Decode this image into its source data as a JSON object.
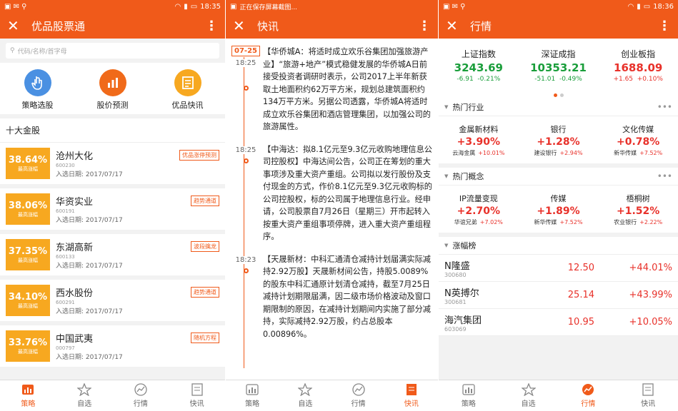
{
  "panel1": {
    "status_time": "18:35",
    "title": "优品股票通",
    "search_placeholder": "代码/名称/首字母",
    "shortcuts": [
      {
        "label": "策略选股",
        "color": "#4a90e2",
        "icon": "hand-pointer-icon"
      },
      {
        "label": "股价预测",
        "color": "#f06a1a",
        "icon": "bar-chart-icon"
      },
      {
        "label": "优品快讯",
        "color": "#f7a820",
        "icon": "news-doc-icon"
      }
    ],
    "section_title": "十大金股",
    "pct_label": "最高涨幅",
    "stocks": [
      {
        "pct": "38.64%",
        "name": "沧州大化",
        "code": "600230",
        "date": "入选日期: 2017/07/17",
        "tag": "优品涨停预测"
      },
      {
        "pct": "38.06%",
        "name": "华资实业",
        "code": "600191",
        "date": "入选日期: 2017/07/17",
        "tag": "趋势通道"
      },
      {
        "pct": "37.35%",
        "name": "东湖高新",
        "code": "600133",
        "date": "入选日期: 2017/07/17",
        "tag": "波段擒龙"
      },
      {
        "pct": "34.10%",
        "name": "西水股份",
        "code": "600291",
        "date": "入选日期: 2017/07/17",
        "tag": "趋势通道"
      },
      {
        "pct": "33.76%",
        "name": "中国武夷",
        "code": "000797",
        "date": "入选日期: 2017/07/17",
        "tag": "随机方程"
      }
    ]
  },
  "panel2": {
    "status_text": "正在保存屏幕截图...",
    "title": "快讯",
    "date_badge": "07-25",
    "news": [
      {
        "time": "18:25",
        "text": "【华侨城A：将适时成立欢乐谷集团加强旅游产业】“旅游+地产”模式稳健发展的华侨城A日前接受投资者调研时表示，公司2017上半年新获取土地面积约62万平方米，规划总建筑面积约134万平方米。另据公司透露，华侨城A将适时成立欢乐谷集团和酒店管理集团，以加强公司的旅游属性。"
      },
      {
        "time": "18:25",
        "text": "【中海达：拟8.1亿元至9.3亿元收购地理信息公司控股权】中海达间公告，公司正在筹划的重大事项涉及重大资产重组。公司拟以发行股份及支付现金的方式，作价8.1亿元至9.3亿元收购标的公司控股权，标的公司属于地理信息行业。经申请，公司股票自7月26日（星期三）开市起转入按重大资产重组事项停牌，进入重大资产重组程序。"
      },
      {
        "time": "18:23",
        "text": "【天晟新材：中科汇通清仓减持计划届满实际减持2.92万股】天晟新材间公告，持股5.0089%的股东中科汇通原计划清仓减持，截至7月25日减持计划期限届满，因二级市场价格波动及窗口期限制的原因，在减持计划期间内实施了部分减持，实际减持2.92万股，约占总股本0.00896%。"
      }
    ]
  },
  "panel3": {
    "status_time": "18:36",
    "title": "行情",
    "indices": [
      {
        "name": "上证指数",
        "value": "3243.69",
        "change": "-6.91",
        "pct": "-0.21%",
        "color": "#1a9e3b"
      },
      {
        "name": "深证成指",
        "value": "10353.21",
        "change": "-51.01",
        "pct": "-0.49%",
        "color": "#1a9e3b"
      },
      {
        "name": "创业板指",
        "value": "1688.09",
        "change": "+1.65",
        "pct": "+0.10%",
        "color": "#e8312a"
      }
    ],
    "hot_industry_title": "热门行业",
    "hot_industry": [
      {
        "name": "金属新材料",
        "pct": "+3.90%",
        "sub": "云海金属",
        "sub_pct": "+10.01%"
      },
      {
        "name": "银行",
        "pct": "+1.28%",
        "sub": "建设银行",
        "sub_pct": "+2.94%"
      },
      {
        "name": "文化传媒",
        "pct": "+0.78%",
        "sub": "新华传媒",
        "sub_pct": "+7.52%"
      }
    ],
    "hot_concept_title": "热门概念",
    "hot_concept": [
      {
        "name": "IP流量变现",
        "pct": "+2.70%",
        "sub": "华谊兄弟",
        "sub_pct": "+7.02%"
      },
      {
        "name": "传媒",
        "pct": "+1.89%",
        "sub": "新华传媒",
        "sub_pct": "+7.52%"
      },
      {
        "name": "梧桐树",
        "pct": "+1.52%",
        "sub": "农业银行",
        "sub_pct": "+2.22%"
      }
    ],
    "gainers_title": "涨幅榜",
    "gainers": [
      {
        "name": "N隆盛",
        "code": "300680",
        "price": "12.50",
        "pct": "+44.01%"
      },
      {
        "name": "N英搏尔",
        "code": "300681",
        "price": "25.14",
        "pct": "+43.99%"
      },
      {
        "name": "海汽集团",
        "code": "603069",
        "price": "10.95",
        "pct": "+10.05%"
      }
    ]
  },
  "tabs": [
    "策略",
    "自选",
    "行情",
    "快讯"
  ],
  "colors": {
    "brand": "#f05a1a",
    "up": "#e8312a",
    "down": "#1a9e3b",
    "gold": "#f7a820"
  }
}
